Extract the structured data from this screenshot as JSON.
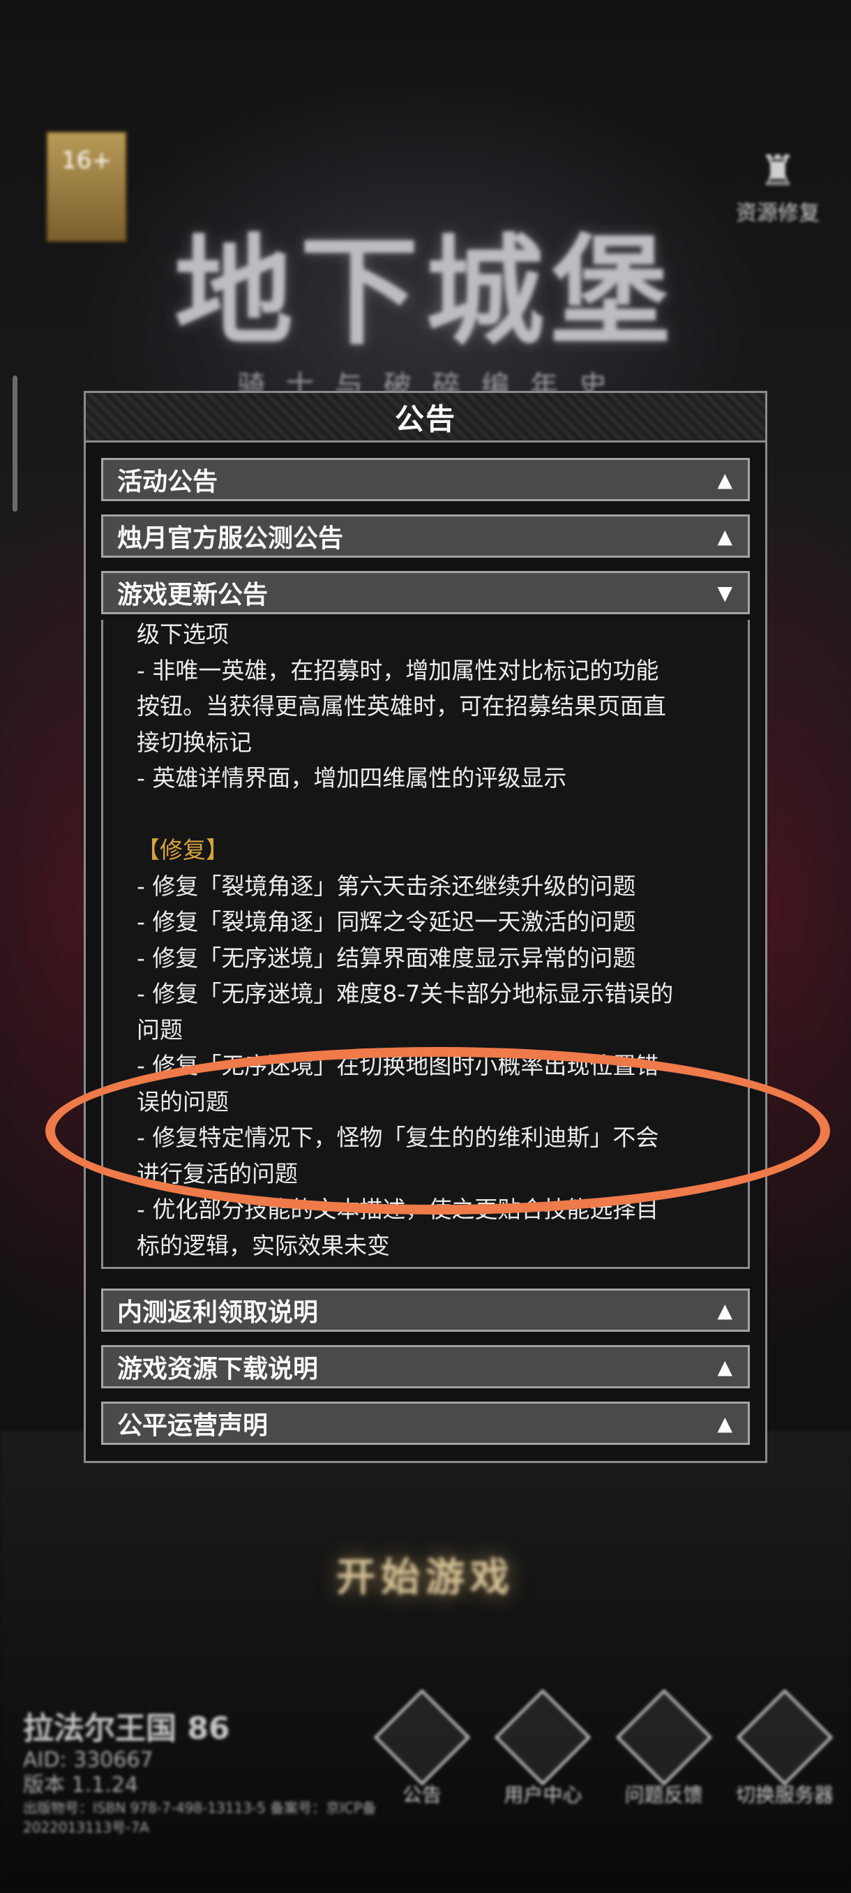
{
  "background": {
    "logo_title": "地下城堡",
    "logo_subtitle": "骑士与破碎编年史",
    "top_right_label": "资源修复",
    "start_button": "开始游戏",
    "server_name": "拉法尔王国 86",
    "aid": "AID: 330667",
    "version": "版本 1.1.24",
    "license_text": "出版物号：ISBN 978-7-498-13113-5 备案号：京ICP备2022013113号-7A",
    "bottom_buttons": [
      "公告",
      "用户中心",
      "问题反馈",
      "切换服务器"
    ]
  },
  "dialog": {
    "title": "公告",
    "sections": [
      {
        "label": "活动公告",
        "expanded": false
      },
      {
        "label": "烛月官方服公测公告",
        "expanded": false
      },
      {
        "label": "游戏更新公告",
        "expanded": true
      },
      {
        "label": "内测返利领取说明",
        "expanded": false
      },
      {
        "label": "游戏资源下载说明",
        "expanded": false
      },
      {
        "label": "公平运营声明",
        "expanded": false
      }
    ],
    "arrow_collapsed": "▲",
    "arrow_expanded": "▼",
    "content_lines": [
      "级下选项",
      "- 非唯一英雄，在招募时，增加属性对比标记的功能",
      "按钮。当获得更高属性英雄时，可在招募结果页面直",
      "接切换标记",
      "- 英雄详情界面，增加四维属性的评级显示",
      "",
      " 【修复】",
      "- 修复「裂境角逐」第六天击杀还继续升级的问题",
      "- 修复「裂境角逐」同辉之令延迟一天激活的问题",
      "- 修复「无序迷境」结算界面难度显示异常的问题",
      "- 修复「无序迷境」难度8-7关卡部分地标显示错误的",
      "问题",
      "- 修复「无序迷境」在切换地图时小概率出现位置错",
      "误的问题",
      "- 修复特定情况下，怪物「复生的的维利迪斯」不会",
      "进行复活的问题",
      "- 优化部分技能的文本描述，使之更贴合技能选择目",
      "标的逻辑，实际效果未变",
      "======================================"
    ]
  }
}
